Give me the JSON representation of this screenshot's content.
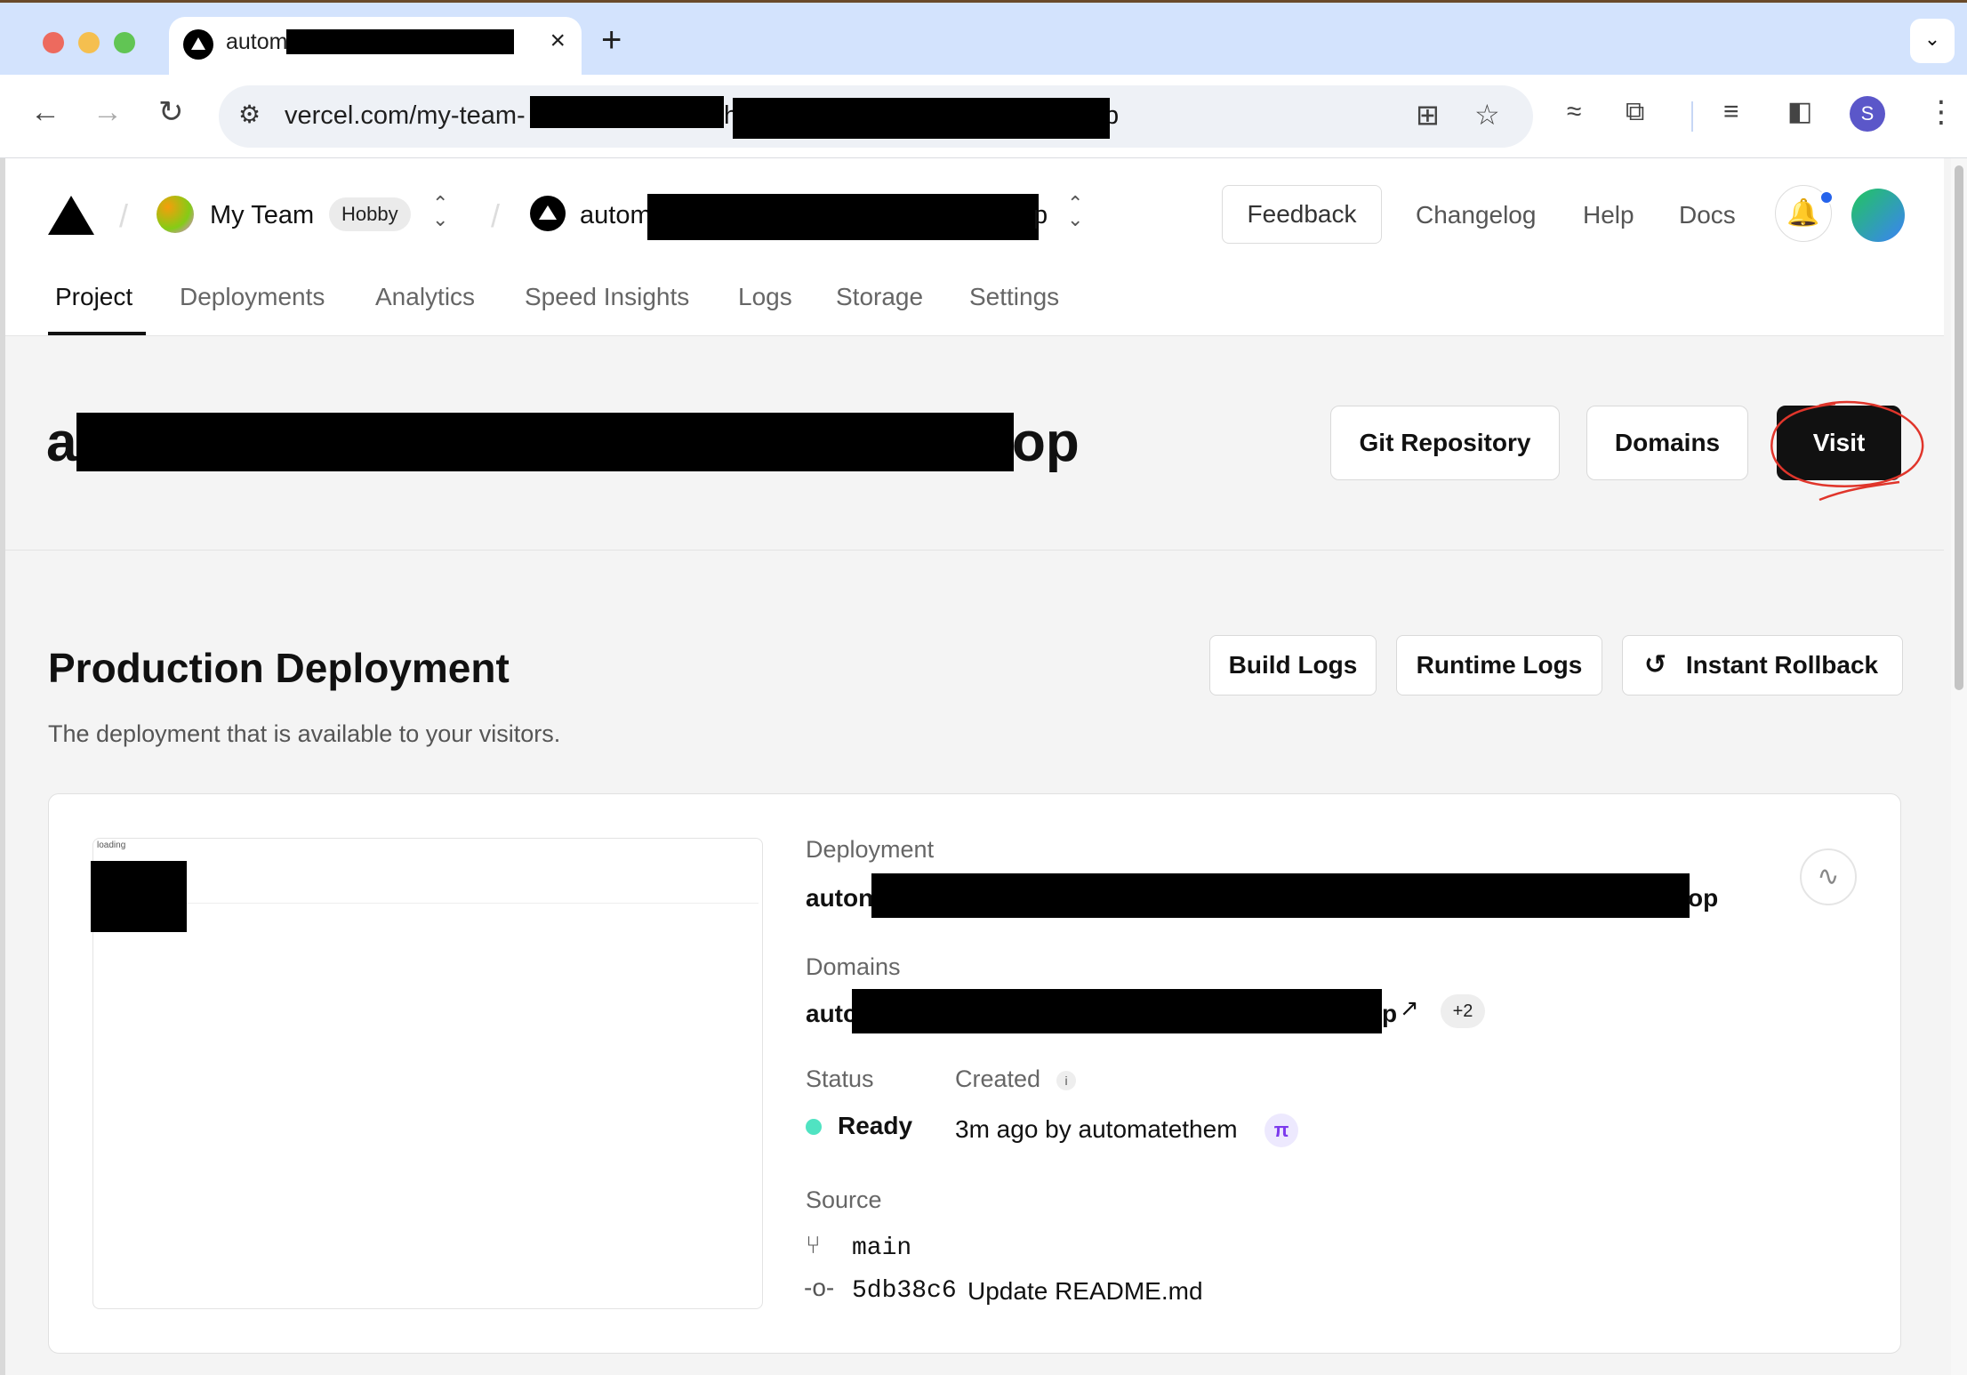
{
  "browser": {
    "tab_title": "autom",
    "tab_close_icon": "×",
    "new_tab_icon": "+",
    "url": "vercel.com/my-team-",
    "url_tail": "p",
    "url_mid": "h",
    "profile_initial": "S"
  },
  "header": {
    "team_name": "My Team",
    "plan_badge": "Hobby",
    "project_name": "autom",
    "project_suffix": "p",
    "links": [
      "Feedback",
      "Changelog",
      "Help",
      "Docs"
    ]
  },
  "nav": {
    "tabs": [
      "Project",
      "Deployments",
      "Analytics",
      "Speed Insights",
      "Logs",
      "Storage",
      "Settings"
    ],
    "active": "Project"
  },
  "project": {
    "title_prefix": "a",
    "title_suffix": "op",
    "buttons": {
      "git": "Git Repository",
      "domains": "Domains",
      "visit": "Visit"
    }
  },
  "production": {
    "title": "Production Deployment",
    "subtitle": "The deployment that is available to your visitors.",
    "buttons": {
      "build_logs": "Build Logs",
      "runtime_logs": "Runtime Logs",
      "instant_rollback": "Instant Rollback"
    },
    "preview_text": "loading",
    "deployment_label": "Deployment",
    "deployment_prefix": "auton",
    "deployment_suffix": "op",
    "domains_label": "Domains",
    "domain_prefix": "autc",
    "domain_suffix": "p",
    "domains_extra": "+2",
    "status_label": "Status",
    "status_value": "Ready",
    "created_label": "Created",
    "created_value": "3m ago by automatethem",
    "source_label": "Source",
    "branch": "main",
    "commit_hash": "5db38c6",
    "commit_message": "Update README.md"
  },
  "colors": {
    "ready": "#50e3c2",
    "visit_annotation": "#e0352b"
  }
}
